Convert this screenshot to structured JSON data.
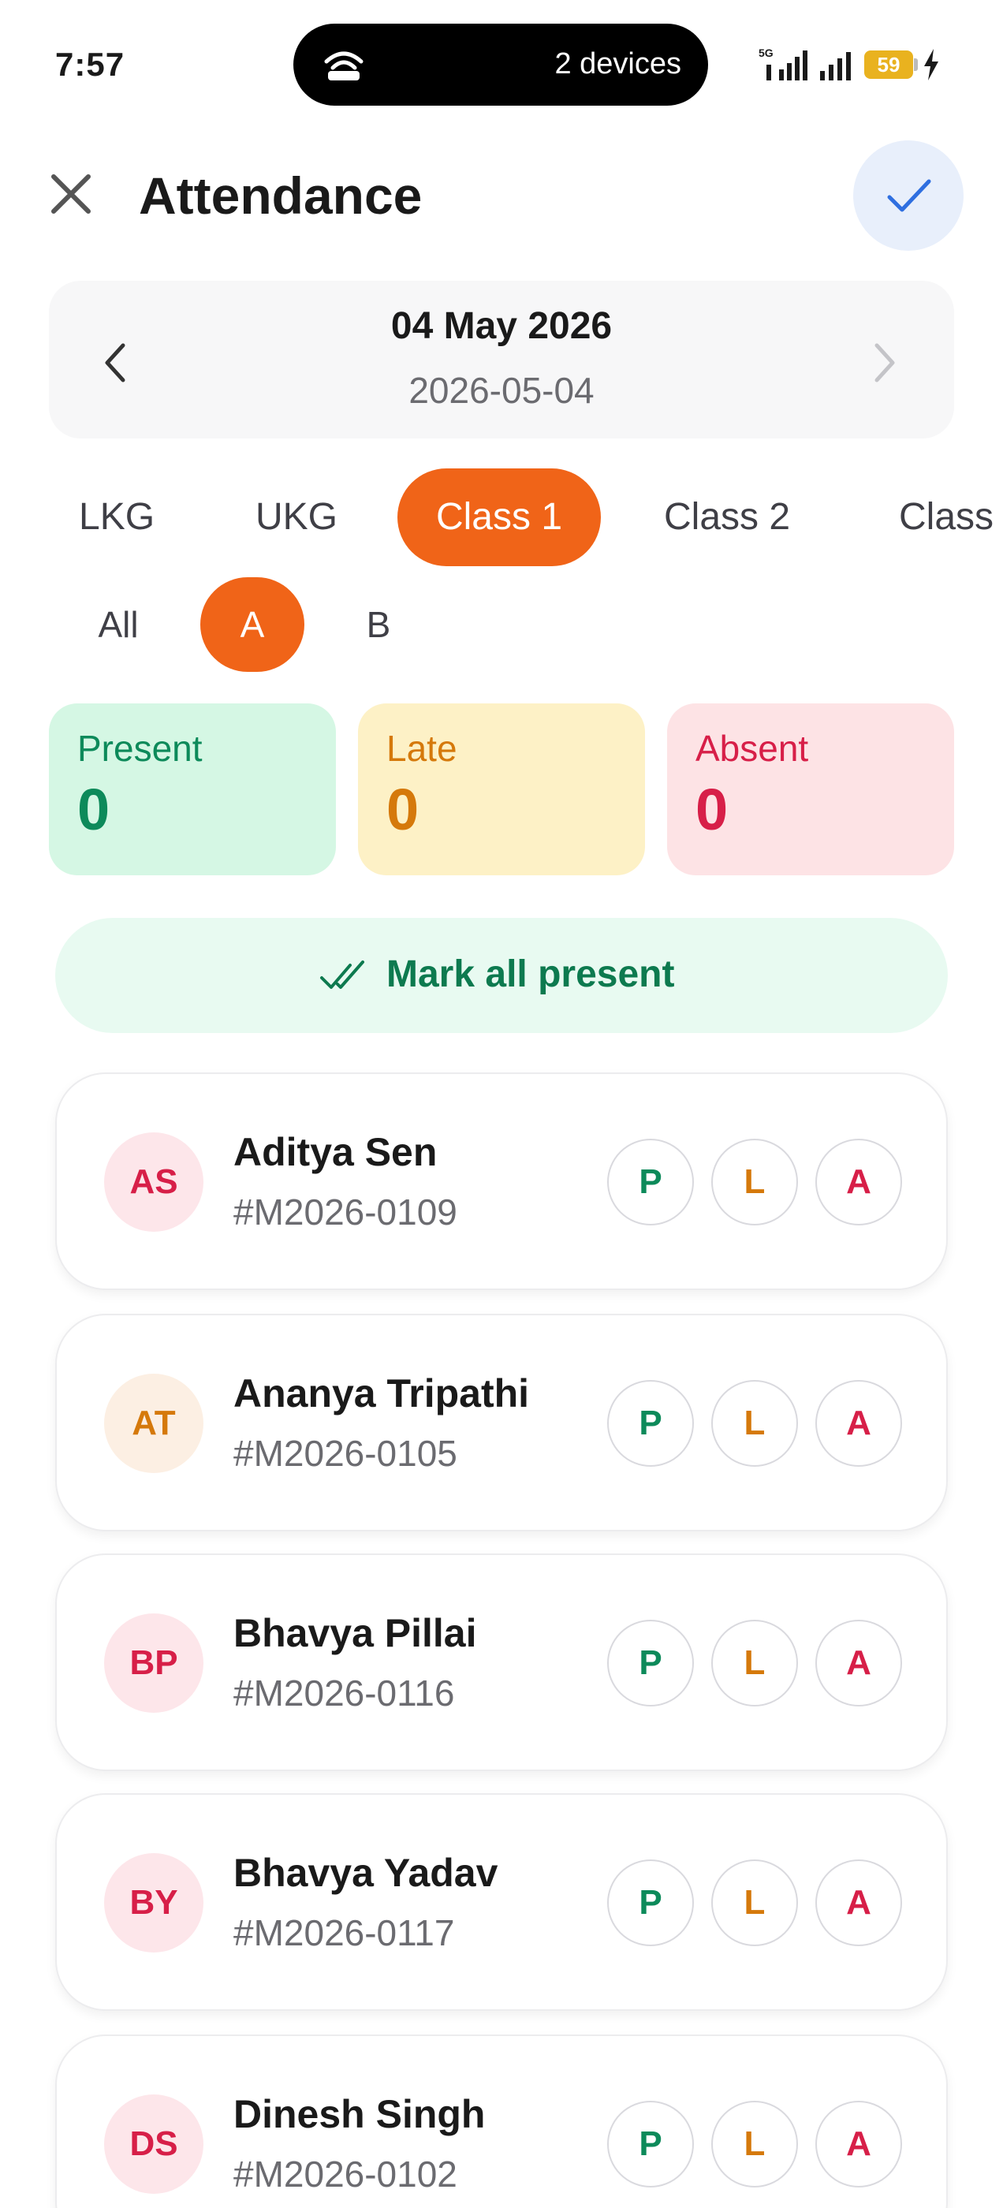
{
  "status_bar": {
    "time": "7:57",
    "hotspot_label": "2 devices",
    "network_label": "5G",
    "battery_level": "59"
  },
  "header": {
    "title": "Attendance"
  },
  "date": {
    "display": "04 May 2026",
    "iso": "2026-05-04"
  },
  "class_tabs": [
    {
      "label": "LKG",
      "active": false
    },
    {
      "label": "UKG",
      "active": false
    },
    {
      "label": "Class 1",
      "active": true
    },
    {
      "label": "Class 2",
      "active": false
    },
    {
      "label": "Class",
      "active": false
    }
  ],
  "section_tabs": [
    {
      "label": "All",
      "active": false
    },
    {
      "label": "A",
      "active": true
    },
    {
      "label": "B",
      "active": false
    }
  ],
  "stats": {
    "present_label": "Present",
    "present_count": "0",
    "late_label": "Late",
    "late_count": "0",
    "absent_label": "Absent",
    "absent_count": "0"
  },
  "mark_all_label": "Mark all present",
  "options": {
    "present": "P",
    "late": "L",
    "absent": "A"
  },
  "students": [
    {
      "initials": "AS",
      "name": "Aditya Sen",
      "id": "#M2026-0109"
    },
    {
      "initials": "AT",
      "name": "Ananya Tripathi",
      "id": "#M2026-0105"
    },
    {
      "initials": "BP",
      "name": "Bhavya Pillai",
      "id": "#M2026-0116"
    },
    {
      "initials": "BY",
      "name": "Bhavya Yadav",
      "id": "#M2026-0117"
    },
    {
      "initials": "DS",
      "name": "Dinesh Singh",
      "id": "#M2026-0102"
    }
  ],
  "colors": {
    "accent": "#f06418",
    "present": "#0d8a5a",
    "late": "#d5790b",
    "absent": "#d71f48",
    "check_blue": "#2f6fe0"
  }
}
